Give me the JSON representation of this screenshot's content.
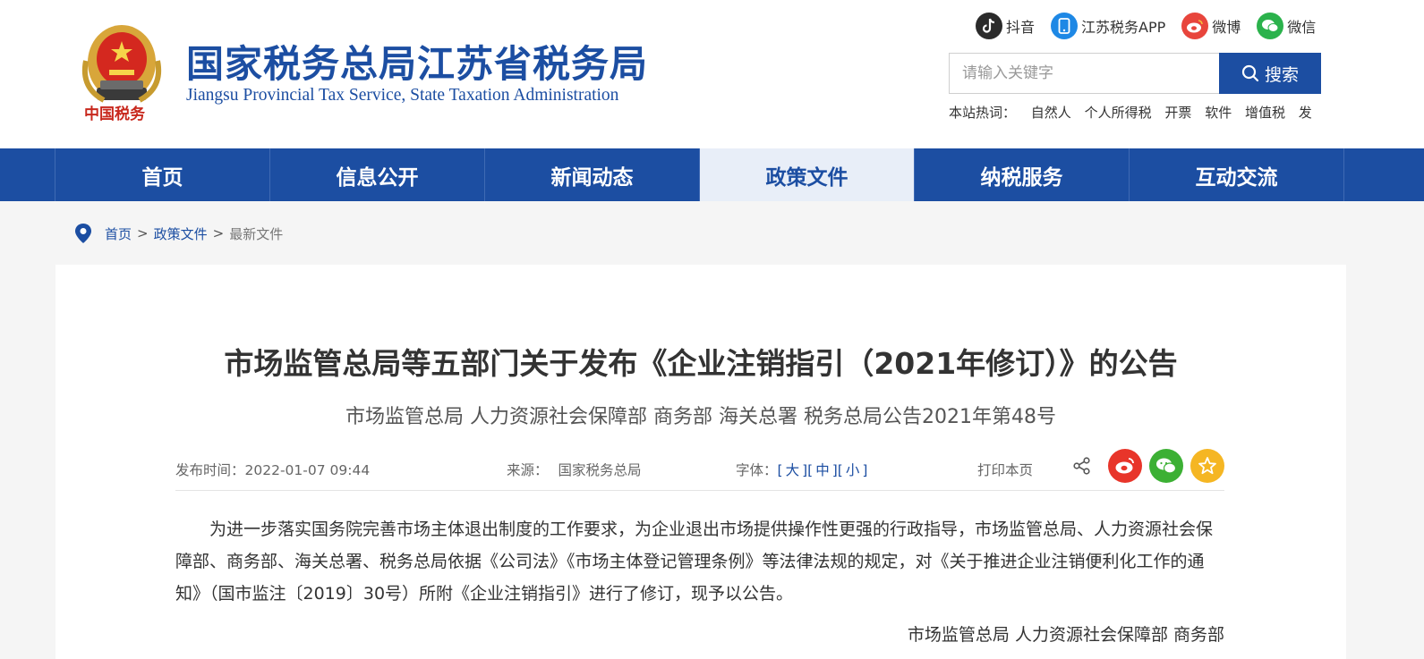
{
  "header": {
    "title_cn": "国家税务总局江苏省税务局",
    "title_en": "Jiangsu Provincial Tax Service, State Taxation Administration",
    "emblem_text": "中国税务",
    "social": [
      {
        "label": "抖音",
        "icon": "tiktok-icon",
        "color": "#2b2b2b"
      },
      {
        "label": "江苏税务APP",
        "icon": "mobile-app-icon",
        "color": "#1e88e5"
      },
      {
        "label": "微博",
        "icon": "weibo-icon",
        "color": "#e8453c"
      },
      {
        "label": "微信",
        "icon": "wechat-icon",
        "color": "#2bb24c"
      }
    ],
    "search": {
      "placeholder": "请输入关键字",
      "button": "搜索"
    },
    "hot": {
      "label": "本站热词：",
      "words": [
        "自然人",
        "个人所得税",
        "开票",
        "软件",
        "增值税",
        "发"
      ]
    }
  },
  "nav": {
    "items": [
      "首页",
      "信息公开",
      "新闻动态",
      "政策文件",
      "纳税服务",
      "互动交流"
    ],
    "active": "政策文件"
  },
  "breadcrumb": {
    "home": "首页",
    "sep": ">",
    "section": "政策文件",
    "current": "最新文件"
  },
  "article": {
    "title": "市场监管总局等五部门关于发布《企业注销指引（2021年修订）》的公告",
    "subtitle": "市场监管总局 人力资源社会保障部 商务部 海关总署 税务总局公告2021年第48号",
    "meta": {
      "date_label": "发布时间：",
      "date": "2022-01-07 09:44",
      "source_label": "来源：",
      "source": "国家税务总局",
      "font_label": "字体：",
      "font_large": "大",
      "font_medium": "中",
      "font_small": "小",
      "print": "打印本页"
    },
    "body": "为进一步落实国务院完善市场主体退出制度的工作要求，为企业退出市场提供操作性更强的行政指导，市场监管总局、人力资源社会保障部、商务部、海关总署、税务总局依据《公司法》《市场主体登记管理条例》等法律法规的规定，对《关于推进企业注销便利化工作的通知》（国市监注〔2019〕30号）所附《企业注销指引》进行了修订，现予以公告。",
    "sign": "市场监管总局  人力资源社会保障部  商务部"
  },
  "colors": {
    "brand_blue": "#1c4ea2",
    "nav_active_bg": "#e8eef8",
    "weibo_red": "#e8352a",
    "wechat_green": "#3cb034",
    "favorite_gold": "#f5b623"
  }
}
